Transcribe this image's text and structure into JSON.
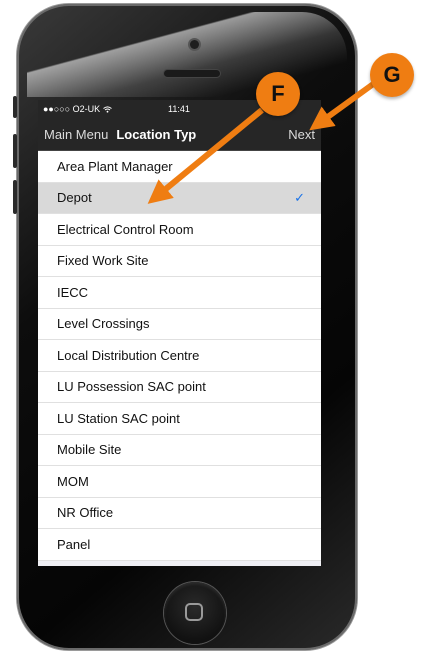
{
  "status_bar": {
    "carrier": "●●○○○ O2-UK",
    "time": "11:41"
  },
  "nav_bar": {
    "back_label": "Main Menu",
    "title": "Location Typ",
    "next_label": "Next"
  },
  "location_list": {
    "selected_index": 1,
    "items": [
      {
        "label": "Area Plant Manager"
      },
      {
        "label": "Depot"
      },
      {
        "label": "Electrical Control Room"
      },
      {
        "label": "Fixed Work Site"
      },
      {
        "label": "IECC"
      },
      {
        "label": "Level Crossings"
      },
      {
        "label": "Local Distribution Centre"
      },
      {
        "label": "LU Possession SAC point"
      },
      {
        "label": "LU Station SAC point"
      },
      {
        "label": "Mobile Site"
      },
      {
        "label": "MOM"
      },
      {
        "label": "NR Office"
      },
      {
        "label": "Panel"
      }
    ]
  },
  "checkmark": "✓",
  "callouts": {
    "f": "F",
    "g": "G"
  },
  "colors": {
    "callout": "#ef7d12",
    "selected_row": "#d9d9d9",
    "checkmark": "#1a73e8"
  }
}
